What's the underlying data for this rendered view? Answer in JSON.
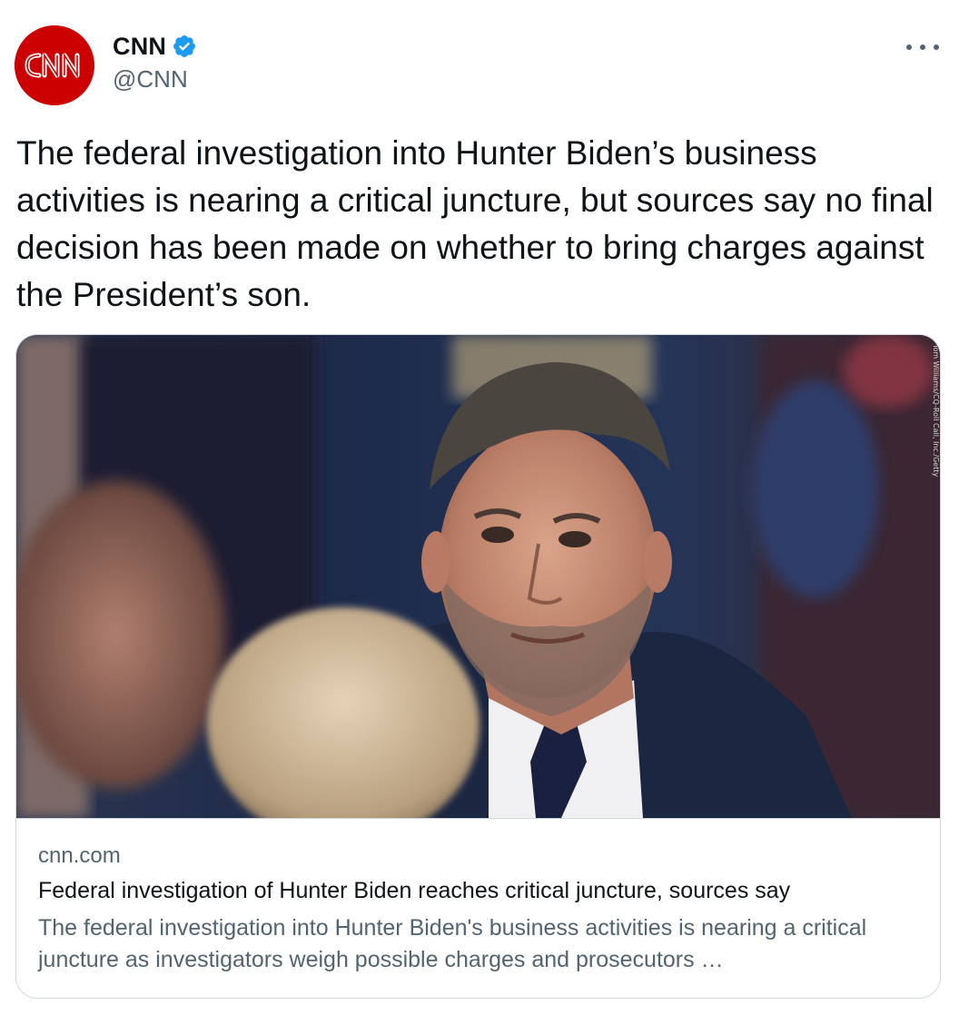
{
  "author": {
    "display_name": "CNN",
    "handle": "@CNN",
    "verified": true,
    "avatar_logo": "CNN",
    "avatar_color": "#cc0000",
    "verified_color": "#1d9bf0"
  },
  "header": {
    "more_icon": "more-horizontal-icon"
  },
  "tweet": {
    "text": "The federal investigation into Hunter Biden’s business activities is nearing a critical juncture, but sources say no final decision has been made on whether to bring charges against the President’s son."
  },
  "card": {
    "domain": "cnn.com",
    "title": "Federal investigation of Hunter Biden reaches critical juncture, sources say",
    "description": "The federal investigation into Hunter Biden's business activities is nearing a critical juncture as investigators weigh possible charges and prosecutors …",
    "image_credit": "Tom Williams/CQ-Roll Call, Inc./Getty"
  },
  "colors": {
    "text_primary": "#0f1419",
    "text_secondary": "#536471",
    "border": "#cfd9de"
  }
}
